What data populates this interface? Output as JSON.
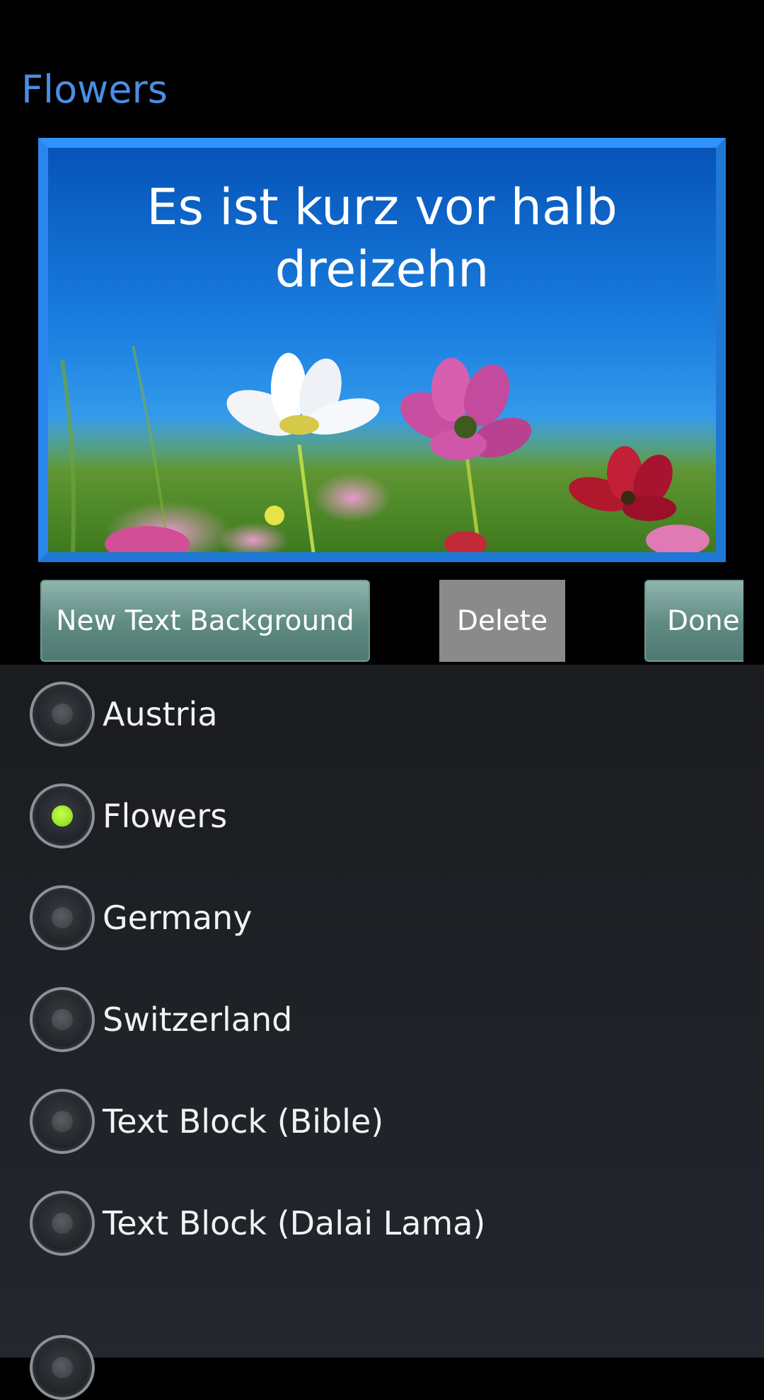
{
  "app": {
    "title": "Flowers"
  },
  "preview": {
    "text": "Es ist kurz vor halb dreizehn"
  },
  "buttons": {
    "new_background": "New Text Background",
    "delete": "Delete",
    "done": "Done"
  },
  "backgrounds": {
    "selected": "Flowers",
    "items": [
      {
        "label": "Austria",
        "checked": false
      },
      {
        "label": "Flowers",
        "checked": true
      },
      {
        "label": "Germany",
        "checked": false
      },
      {
        "label": "Switzerland",
        "checked": false
      },
      {
        "label": "Text Block (Bible)",
        "checked": false
      },
      {
        "label": "Text Block (Dalai Lama)",
        "checked": false
      }
    ]
  },
  "colors": {
    "title": "#4a8ee3",
    "preview_border": "#1e78d6",
    "button_green": "#6d958d",
    "button_delete": "#8a8a8a",
    "radio_checked": "#9be22a"
  }
}
